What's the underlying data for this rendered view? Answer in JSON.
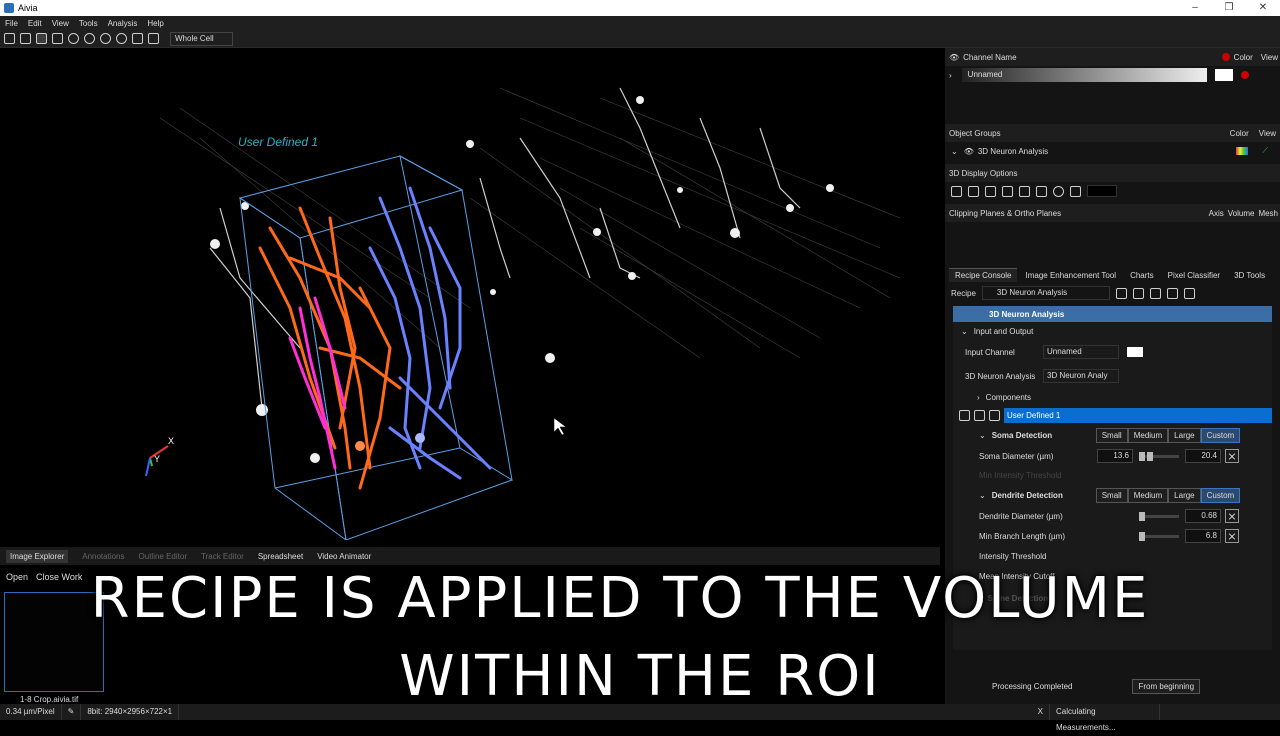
{
  "window": {
    "title": "Aivia"
  },
  "menu": [
    "File",
    "Edit",
    "View",
    "Tools",
    "Analysis",
    "Help"
  ],
  "toolbar": {
    "roi_mode": "Whole Cell"
  },
  "viewport": {
    "roi_label": "User Defined 1",
    "axis_x": "X",
    "axis_y": "Y"
  },
  "bottom_tabs": [
    {
      "label": "Image Explorer",
      "state": "active"
    },
    {
      "label": "Annotations",
      "state": "dim"
    },
    {
      "label": "Outline Editor",
      "state": "dim"
    },
    {
      "label": "Track Editor",
      "state": "dim"
    },
    {
      "label": "Spreadsheet",
      "state": "normal"
    },
    {
      "label": "Video Animator",
      "state": "normal"
    }
  ],
  "explorer": {
    "open_label": "Open",
    "close_label": "Close Work",
    "file_name": "1-8 Crop.aivia.tif"
  },
  "status": {
    "pixel": "0.34 µm/Pixel",
    "dims": "8bit: 2940×2956×722×1",
    "task": "Calculating Measurements..."
  },
  "channels": {
    "header": "Channel Name",
    "color_label": "Color",
    "view_label": "View",
    "channel_name": "Unnamed"
  },
  "object_groups": {
    "header": "Object Groups",
    "color_label": "Color",
    "view_label": "View",
    "item": "3D Neuron Analysis"
  },
  "display_options": {
    "header": "3D Display Options"
  },
  "clipping": {
    "header": "Clipping Planes & Ortho Planes",
    "axis": "Axis",
    "volume": "Volume",
    "mesh": "Mesh"
  },
  "tabs": [
    "Recipe Console",
    "Image Enhancement Tool",
    "Charts",
    "Pixel Classifier",
    "3D Tools"
  ],
  "recipe": {
    "label": "Recipe",
    "name": "3D Neuron Analysis",
    "title": "3D Neuron Analysis",
    "section_io": "Input and Output",
    "input_channel_label": "Input Channel",
    "input_channel_value": "Unnamed",
    "analysis_label": "3D Neuron Analysis",
    "analysis_value": "3D Neuron Analy",
    "components": "Components",
    "selected_roi": "User Defined 1",
    "soma_title": "Soma Detection",
    "soma_diameter_label": "Soma Diameter (µm)",
    "soma_min": "13.6",
    "soma_max": "20.4",
    "soma_hidden": "Min Intensity Threshold",
    "dendrite_title": "Dendrite Detection",
    "dendrite_diameter_label": "Dendrite Diameter (µm)",
    "dendrite_diameter": "0.68",
    "branch_length_label": "Min Branch Length (µm)",
    "branch_length": "6.8",
    "intensity_label": "Intensity Threshold",
    "mean_label": "Mean Intensity Cutoff",
    "spine_title": "Spine Detection",
    "sizes": [
      "Small",
      "Medium",
      "Large",
      "Custom"
    ],
    "processing_status": "Processing Completed",
    "from_beginning": "From beginning"
  },
  "caption": {
    "line1": "RECIPE IS APPLIED TO THE VOLUME",
    "line2": "WITHIN THE ROI"
  }
}
